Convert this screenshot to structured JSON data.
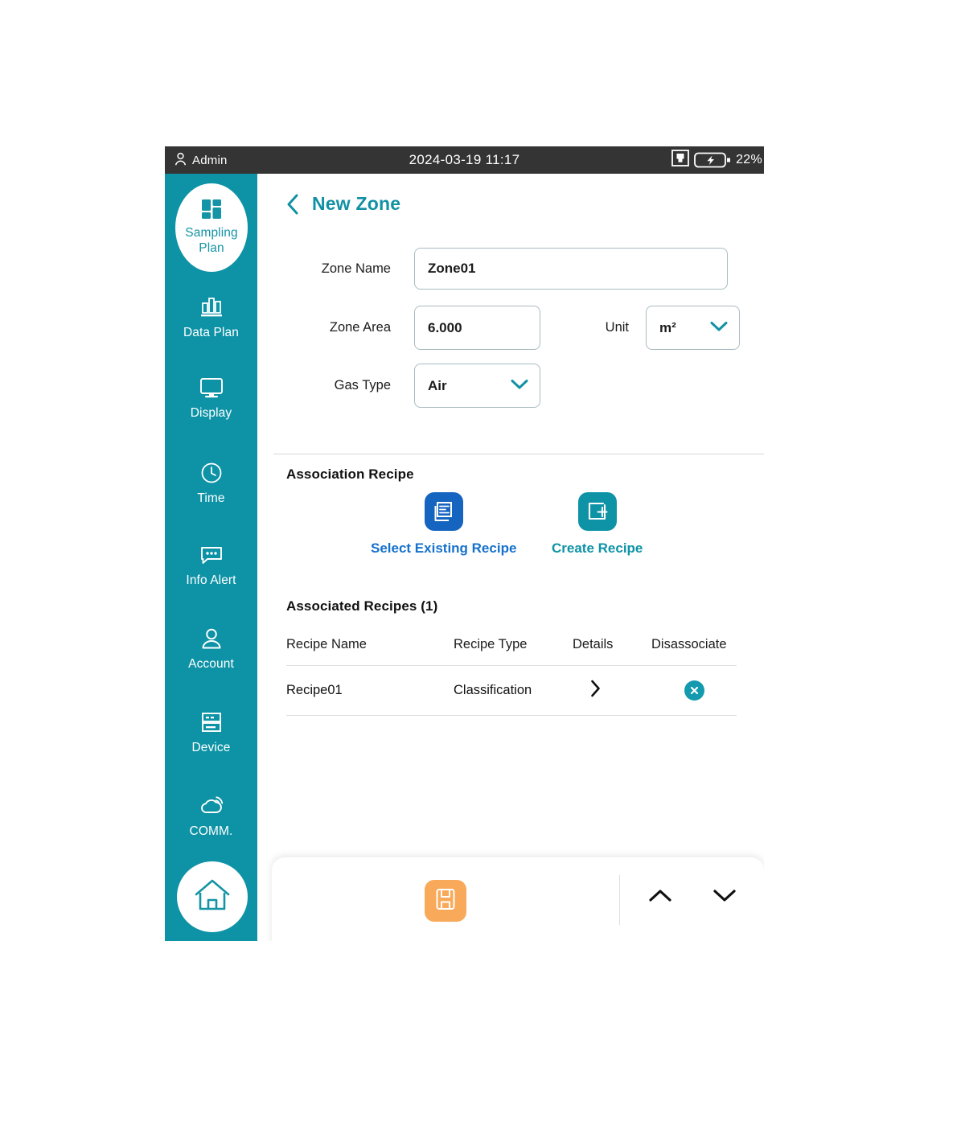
{
  "statusbar": {
    "user": "Admin",
    "user_icon": "person-icon",
    "datetime": "2024-03-19 11:17",
    "network_icon": "ethernet-icon",
    "battery_icon": "battery-charging-icon",
    "battery_percent": "22%"
  },
  "sidebar": {
    "background": "#0e93a6",
    "items": [
      {
        "label": "Sampling\nPlan",
        "label_line1": "Sampling",
        "label_line2": "Plan",
        "icon": "grid-icon",
        "active": true
      },
      {
        "label": "Data Plan",
        "icon": "bar-chart-icon",
        "active": false
      },
      {
        "label": "Display",
        "icon": "monitor-icon",
        "active": false
      },
      {
        "label": "Time",
        "icon": "clock-icon",
        "active": false
      },
      {
        "label": "Info Alert",
        "icon": "chat-bubble-icon",
        "active": false
      },
      {
        "label": "Account",
        "icon": "person-icon",
        "active": false
      },
      {
        "label": "Device",
        "icon": "server-icon",
        "active": false
      },
      {
        "label": "COMM.",
        "icon": "cloud-signal-icon",
        "active": false
      }
    ],
    "home_icon": "home-icon"
  },
  "page": {
    "back_icon": "chevron-left-icon",
    "title": "New Zone"
  },
  "form": {
    "zone_name_label": "Zone Name",
    "zone_name_value": "Zone01",
    "zone_area_label": "Zone Area",
    "zone_area_value": "6.000",
    "unit_label": "Unit",
    "unit_value": "m²",
    "gas_type_label": "Gas Type",
    "gas_type_value": "Air",
    "dropdown_icon": "chevron-down-icon"
  },
  "association": {
    "section_title": "Association Recipe",
    "select_existing_label": "Select Existing Recipe",
    "select_existing_icon": "documents-stack-icon",
    "select_existing_color": "#1565C0",
    "create_label": "Create Recipe",
    "create_icon": "add-square-icon",
    "create_color": "#0e93a6",
    "list_title": "Associated Recipes (1)"
  },
  "table": {
    "columns": [
      "Recipe Name",
      "Recipe Type",
      "Details",
      "Disassociate"
    ],
    "rows": [
      {
        "recipe_name": "Recipe01",
        "recipe_type": "Classification",
        "details_icon": "chevron-right-icon",
        "disassociate_icon": "close-circle-icon"
      }
    ]
  },
  "bottombar": {
    "save_icon": "save-floppy-icon",
    "save_color": "#f9aköser",
    "scroll_up_icon": "chevron-up-icon",
    "scroll_down_icon": "chevron-down-icon"
  }
}
